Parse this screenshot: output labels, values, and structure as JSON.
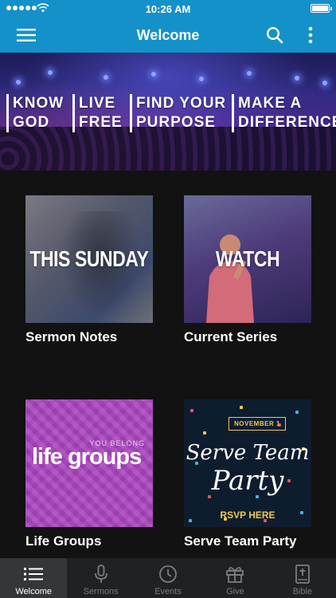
{
  "status_bar": {
    "time": "10:26 AM"
  },
  "app_bar": {
    "title": "Welcome"
  },
  "hero": {
    "phrases": [
      {
        "line1": "KNOW",
        "line2": "GOD"
      },
      {
        "line1": "LIVE",
        "line2": "FREE"
      },
      {
        "line1": "FIND YOUR",
        "line2": "PURPOSE"
      },
      {
        "line1": "MAKE A",
        "line2": "DIFFERENCE"
      }
    ]
  },
  "tiles": [
    {
      "thumb_text": "THIS SUNDAY",
      "label": "Sermon Notes"
    },
    {
      "thumb_text": "WATCH",
      "label": "Current Series"
    },
    {
      "thumb_top": "YOU BELONG",
      "thumb_text": "life groups",
      "label": "Life Groups"
    },
    {
      "badge": "NOVEMBER 1",
      "script_line1": "Serve Team",
      "script_line2": "Party",
      "rsvp": "RSVP HERE",
      "label": "Serve Team Party"
    }
  ],
  "tab_bar": {
    "tabs": [
      {
        "label": "Welcome",
        "icon": "list-icon",
        "active": true
      },
      {
        "label": "Sermons",
        "icon": "microphone-icon",
        "active": false
      },
      {
        "label": "Events",
        "icon": "clock-icon",
        "active": false
      },
      {
        "label": "Give",
        "icon": "gift-icon",
        "active": false
      },
      {
        "label": "Bible",
        "icon": "bible-icon",
        "active": false
      }
    ]
  },
  "colors": {
    "header": "#1591c9",
    "background": "#121212",
    "tab_bar": "#202124",
    "tab_active": "#34363a"
  }
}
